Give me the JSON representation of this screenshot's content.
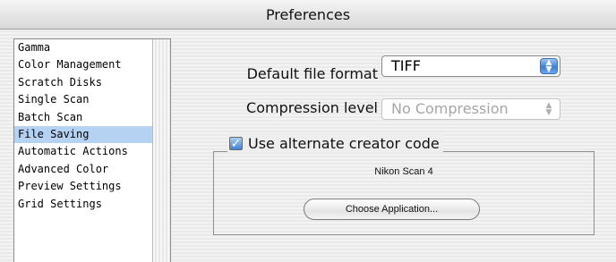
{
  "window": {
    "title": "Preferences"
  },
  "sidebar": {
    "items": [
      {
        "label": "Gamma",
        "selected": false
      },
      {
        "label": "Color Management",
        "selected": false
      },
      {
        "label": "Scratch Disks",
        "selected": false
      },
      {
        "label": "Single Scan",
        "selected": false
      },
      {
        "label": "Batch Scan",
        "selected": false
      },
      {
        "label": "File Saving",
        "selected": true
      },
      {
        "label": "Automatic Actions",
        "selected": false
      },
      {
        "label": "Advanced Color",
        "selected": false
      },
      {
        "label": "Preview Settings",
        "selected": false
      },
      {
        "label": "Grid Settings",
        "selected": false
      }
    ]
  },
  "file_saving": {
    "default_format_label": "Default file format",
    "default_format_value": "TIFF",
    "compression_label": "Compression level",
    "compression_value": "No Compression",
    "compression_enabled": false,
    "creator_code_label": "Use alternate creator code",
    "creator_code_checked": true,
    "application_name": "Nikon Scan 4",
    "choose_button_label": "Choose Application..."
  },
  "icons": {
    "popup_arrows": "updown-arrows-icon",
    "checkbox": "checkmark-icon"
  },
  "colors": {
    "selection": "#b5d2f3",
    "accent": "#3c7fd6"
  }
}
